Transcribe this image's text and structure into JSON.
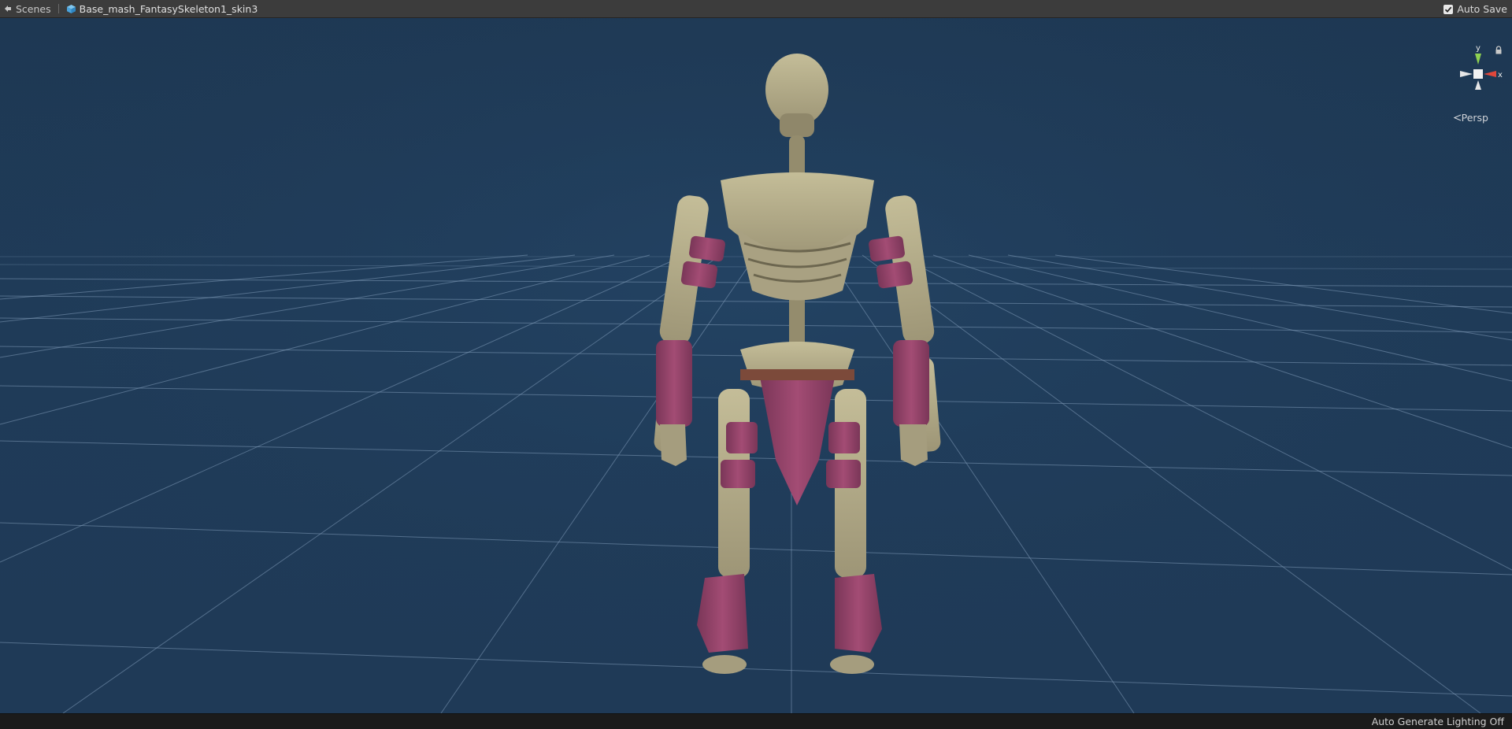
{
  "breadcrumb": {
    "scenes_label": "Scenes",
    "prefab_label": "Base_mash_FantasySkeleton1_skin3"
  },
  "toolbar": {
    "auto_save_label": "Auto Save",
    "auto_save_checked": true
  },
  "scene_view": {
    "projection_label": "Persp",
    "gizmo_axes": {
      "y": "y",
      "x": "x"
    },
    "background_color": "#1f3a57",
    "grid_color": "#6e89a6"
  },
  "status_bar": {
    "lighting_label": "Auto Generate Lighting Off"
  },
  "icons": [
    "scenes-icon",
    "prefab-cube-icon",
    "checkmark-icon",
    "lock-icon",
    "persp-icon"
  ]
}
